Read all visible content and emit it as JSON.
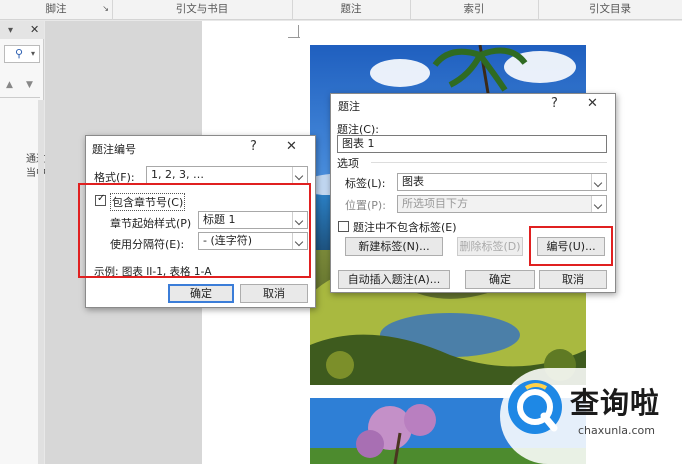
{
  "ribbon": {
    "groups": [
      "脚注",
      "引文与书目",
      "题注",
      "索引",
      "引文目录"
    ]
  },
  "navpane": {
    "close": "✕",
    "text_lines": [
      "通过",
      "当中"
    ]
  },
  "dialog_caption": {
    "title": "题注",
    "help": "?",
    "close": "✕",
    "caption_label": "题注(C):",
    "caption_value": "图表 1",
    "options_label": "选项",
    "label_label": "标签(L):",
    "label_value": "图表",
    "position_label": "位置(P):",
    "position_value": "所选项目下方",
    "exclude_label": "题注中不包含标签(E)",
    "new_label": "新建标签(N)...",
    "delete_label": "删除标签(D)",
    "numbering": "编号(U)...",
    "autocaption": "自动插入题注(A)...",
    "ok": "确定",
    "cancel": "取消"
  },
  "dialog_numbering": {
    "title": "题注编号",
    "help": "?",
    "close": "✕",
    "format_label": "格式(F):",
    "format_value": "1, 2, 3, …",
    "include_chapter": "包含章节号(C)",
    "chapter_style_label": "章节起始样式(P)",
    "chapter_style_value": "标题 1",
    "separator_label": "使用分隔符(E):",
    "separator_value": "-  (连字符)",
    "example": "示例: 图表 II-1, 表格 1-A",
    "ok": "确定",
    "cancel": "取消"
  },
  "watermark": {
    "name": "查询啦",
    "url": "chaxunla.com"
  },
  "colors": {
    "accent": "#3b7dd8",
    "highlight": "#e02020",
    "brand": "#1e88e5"
  }
}
